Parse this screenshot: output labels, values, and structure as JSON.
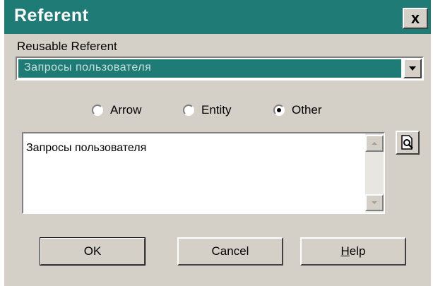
{
  "window": {
    "title": "Referent",
    "close_label": "x"
  },
  "reusable": {
    "label": "Reusable Referent",
    "selected_value": "Запросы пользователя"
  },
  "radio_group": {
    "options": [
      {
        "label": "Arrow",
        "checked": false
      },
      {
        "label": "Entity",
        "checked": false
      },
      {
        "label": "Other",
        "checked": true
      }
    ]
  },
  "text_area": {
    "value": "Запросы пользователя"
  },
  "buttons": {
    "ok_label": "OK",
    "cancel_label": "Cancel",
    "help_label": "Help"
  },
  "colors": {
    "titlebar": "#1e7b75",
    "face": "#d4d0c8",
    "selection": "#1e7b75"
  },
  "icons": {
    "close": "close-icon",
    "dropdown": "chevron-down-icon",
    "preview": "preview-document-icon",
    "scroll_up": "scroll-up-icon",
    "scroll_down": "scroll-down-icon"
  }
}
